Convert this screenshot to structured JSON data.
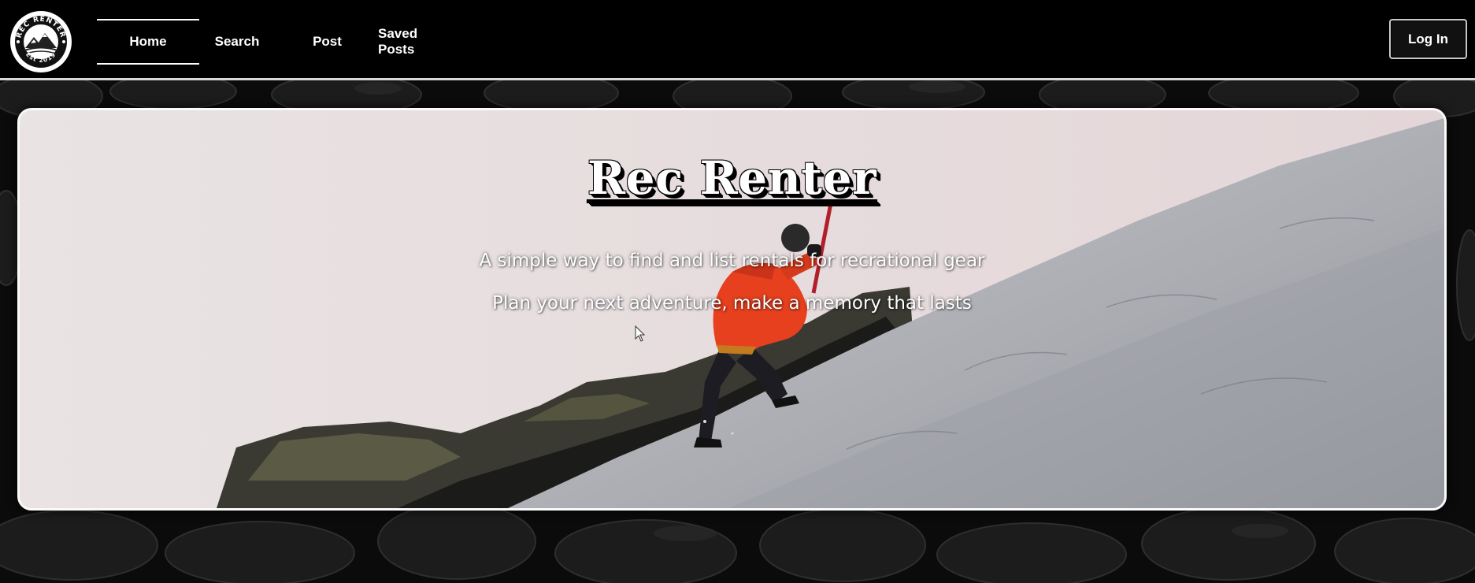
{
  "nav": {
    "logo": {
      "icon": "rec-renter-logo-icon",
      "ring_text_top": "REC RENTER",
      "ring_text_bottom": "Est 2019"
    },
    "items": [
      {
        "label": "Home",
        "active": true
      },
      {
        "label": "Search",
        "active": false
      },
      {
        "label": "Post",
        "active": false
      },
      {
        "label": "Saved Posts",
        "active": false
      }
    ],
    "login_label": "Log In"
  },
  "hero": {
    "title": "Rec Renter",
    "subtitle_1": "A simple way to find and list rentals for recrational gear",
    "subtitle_2": "Plan your next adventure, make a memory that lasts",
    "image": "ice-climber-on-glacier-slope"
  },
  "colors": {
    "nav_background": "#000000",
    "page_background": "#0c0c0c",
    "hero_sky": "#e8e0e0",
    "jacket_accent": "#e6401e",
    "text": "#ffffff"
  }
}
